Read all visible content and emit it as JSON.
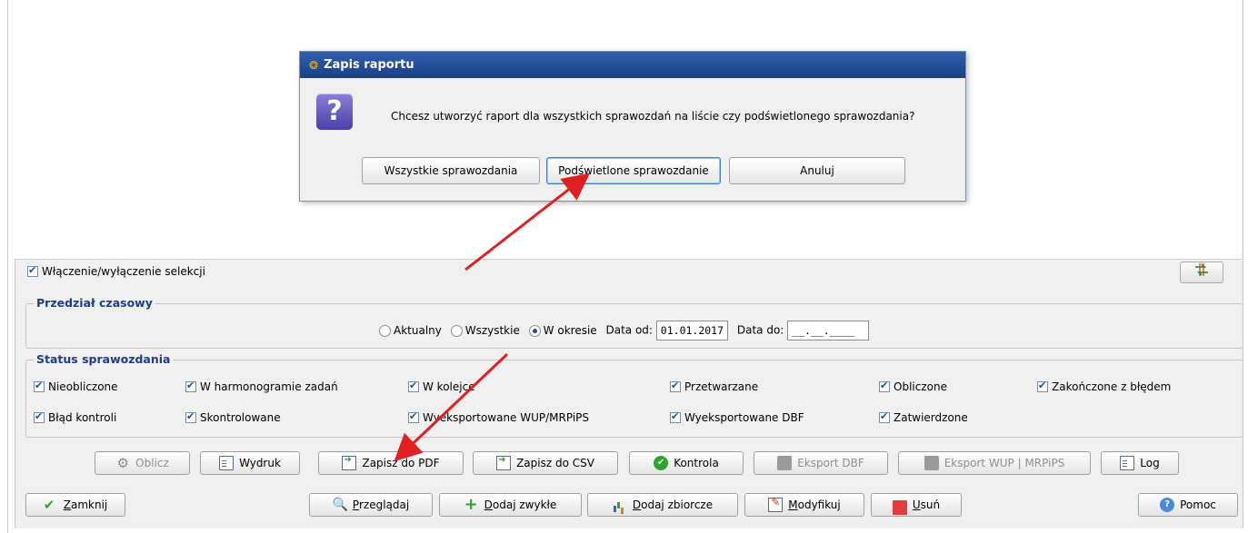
{
  "dialog": {
    "title": "Zapis raportu",
    "message": "Chcesz utworzyć raport dla wszystkich sprawozdań na liście czy podświetlonego sprawozdania?",
    "buttons": {
      "all": "Wszystkie sprawozdania",
      "highlighted": "Podświetlone sprawozdanie",
      "cancel": "Anuluj"
    }
  },
  "selection": {
    "label": "Włączenie/wyłączenie selekcji",
    "checked": true
  },
  "period": {
    "legend": "Przedział czasowy",
    "options": [
      "Aktualny",
      "Wszystkie",
      "W okresie"
    ],
    "selected": "W okresie",
    "date_from_label": "Data od:",
    "date_from": "01.01.2017",
    "date_to_label": "Data do:",
    "date_to": "__.__.____"
  },
  "status": {
    "legend": "Status sprawozdania",
    "items": [
      "Nieobliczone",
      "W harmonogramie zadań",
      "W kolejce",
      "Przetwarzane",
      "Obliczone",
      "Zakończone z błędem",
      "Błąd kontroli",
      "Skontrolowane",
      "Wyeksportowane WUP/MRPiPS",
      "Wyeksportowane DBF",
      "Zatwierdzone"
    ]
  },
  "toolbar1": {
    "oblicz": "Oblicz",
    "wydruk": "Wydruk",
    "zapisz_pdf": "Zapisz do PDF",
    "zapisz_csv": "Zapisz do CSV",
    "kontrola": "Kontrola",
    "eksport_dbf": "Eksport DBF",
    "eksport_wup": "Eksport WUP | MRPiPS",
    "log": "Log"
  },
  "toolbar2": {
    "zamknij_first": "Z",
    "zamknij_rest": "amknij",
    "przegladaj_first": "P",
    "przegladaj_rest": "rzeglądaj",
    "dodaj_zwykle_first": "D",
    "dodaj_zwykle_rest": "odaj zwykłe",
    "dodaj_zbiorcze_first": "D",
    "dodaj_zbiorcze_rest": "odaj zbiorcze",
    "modyfikuj_first": "M",
    "modyfikuj_rest": "odyfikuj",
    "usun_first": "U",
    "usun_rest": "suń",
    "pomoc": "Pomoc"
  },
  "colors": {
    "accent_blue": "#1d3d8a",
    "titlebar": "#2e5fae",
    "annotation_arrow": "#e02020"
  }
}
